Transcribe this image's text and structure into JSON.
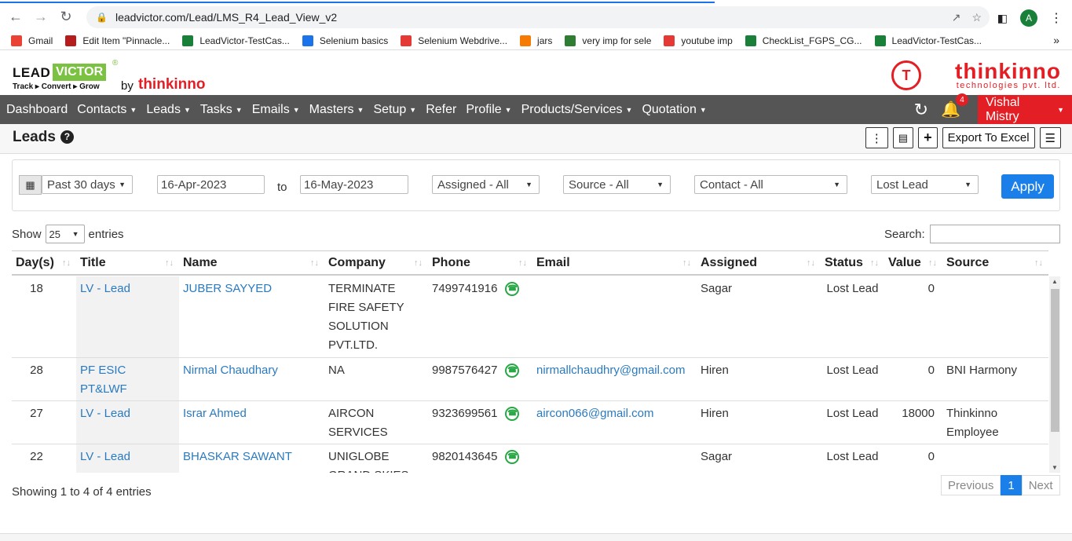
{
  "browser": {
    "url": "leadvictor.com/Lead/LMS_R4_Lead_View_v2",
    "avatar_letter": "A",
    "bookmarks": [
      {
        "label": "Gmail",
        "icon": "gmail-icon",
        "color": "#ea4335"
      },
      {
        "label": "Edit Item \"Pinnacle...",
        "icon": "edit-item-icon",
        "color": "#b71c1c"
      },
      {
        "label": "LeadVictor-TestCas...",
        "icon": "sheets-icon",
        "color": "#188038"
      },
      {
        "label": "Selenium basics",
        "icon": "selenium-icon",
        "color": "#1a73e8"
      },
      {
        "label": "Selenium Webdrive...",
        "icon": "vivaldi-icon",
        "color": "#e53935"
      },
      {
        "label": "jars",
        "icon": "blogger-icon",
        "color": "#f57c00"
      },
      {
        "label": "very imp for sele",
        "icon": "s-icon",
        "color": "#2e7d32"
      },
      {
        "label": "youtube imp",
        "icon": "youtube-icon",
        "color": "#e53935"
      },
      {
        "label": "CheckList_FGPS_CG...",
        "icon": "sheets-icon",
        "color": "#188038"
      },
      {
        "label": "LeadVictor-TestCas...",
        "icon": "sheets-icon",
        "color": "#188038"
      }
    ],
    "more": "»"
  },
  "brand": {
    "lead": "LEAD",
    "victor": "VICTOR",
    "reg": "®",
    "tagline": "Track ▸ Convert ▸ Grow",
    "by": "by",
    "thinkinno": "thinkinno",
    "right_name": "thinkinno",
    "right_sub": "technologies pvt. ltd.",
    "circle": "T"
  },
  "menu": [
    {
      "label": "Dashboard",
      "caret": false
    },
    {
      "label": "Contacts",
      "caret": true
    },
    {
      "label": "Leads",
      "caret": true
    },
    {
      "label": "Tasks",
      "caret": true
    },
    {
      "label": "Emails",
      "caret": true
    },
    {
      "label": "Masters",
      "caret": true
    },
    {
      "label": "Setup",
      "caret": true
    },
    {
      "label": "Refer",
      "caret": false
    },
    {
      "label": "Profile",
      "caret": true
    },
    {
      "label": "Products/Services",
      "caret": true
    },
    {
      "label": "Quotation",
      "caret": true
    }
  ],
  "notifications": "4",
  "user": "Vishal Mistry",
  "page": {
    "title": "Leads",
    "export_label": "Export To Excel"
  },
  "filters": {
    "range": "Past 30 days",
    "from": "16-Apr-2023",
    "to_label": "to",
    "to": "16-May-2023",
    "assigned": "Assigned - All",
    "source": "Source - All",
    "contact": "Contact - All",
    "status": "Lost Lead",
    "apply": "Apply"
  },
  "table_controls": {
    "show": "Show",
    "page_length": "25",
    "entries": "entries",
    "search_label": "Search:"
  },
  "columns": [
    "Day(s)",
    "Title",
    "Name",
    "Company",
    "Phone",
    "Email",
    "Assigned",
    "Status",
    "Value",
    "Source"
  ],
  "rows": [
    {
      "days": "18",
      "title": "LV - Lead",
      "name": "JUBER SAYYED",
      "company": "TERMINATE FIRE SAFETY SOLUTION PVT.LTD.",
      "phone": "7499741916",
      "email": "",
      "assigned": "Sagar",
      "status": "Lost Lead",
      "value": "0",
      "source": ""
    },
    {
      "days": "28",
      "title": "PF ESIC PT&LWF",
      "name": "Nirmal Chaudhary",
      "company": "NA",
      "phone": "9987576427",
      "email": "nirmallchaudhry@gmail.com",
      "assigned": "Hiren",
      "status": "Lost Lead",
      "value": "0",
      "source": "BNI Harmony"
    },
    {
      "days": "27",
      "title": "LV - Lead",
      "name": "Israr Ahmed",
      "company": "AIRCON SERVICES",
      "phone": "9323699561",
      "email": "aircon066@gmail.com",
      "assigned": "Hiren",
      "status": "Lost Lead",
      "value": "18000",
      "source": "Thinkinno Employee"
    },
    {
      "days": "22",
      "title": "LV - Lead",
      "name": "BHASKAR SAWANT",
      "company": "UNIGLOBE GRAND SKIES",
      "phone": "9820143645",
      "email": "",
      "assigned": "Sagar",
      "status": "Lost Lead",
      "value": "0",
      "source": ""
    }
  ],
  "footer": {
    "info": "Showing 1 to 4 of 4 entries",
    "previous": "Previous",
    "page": "1",
    "next": "Next"
  }
}
